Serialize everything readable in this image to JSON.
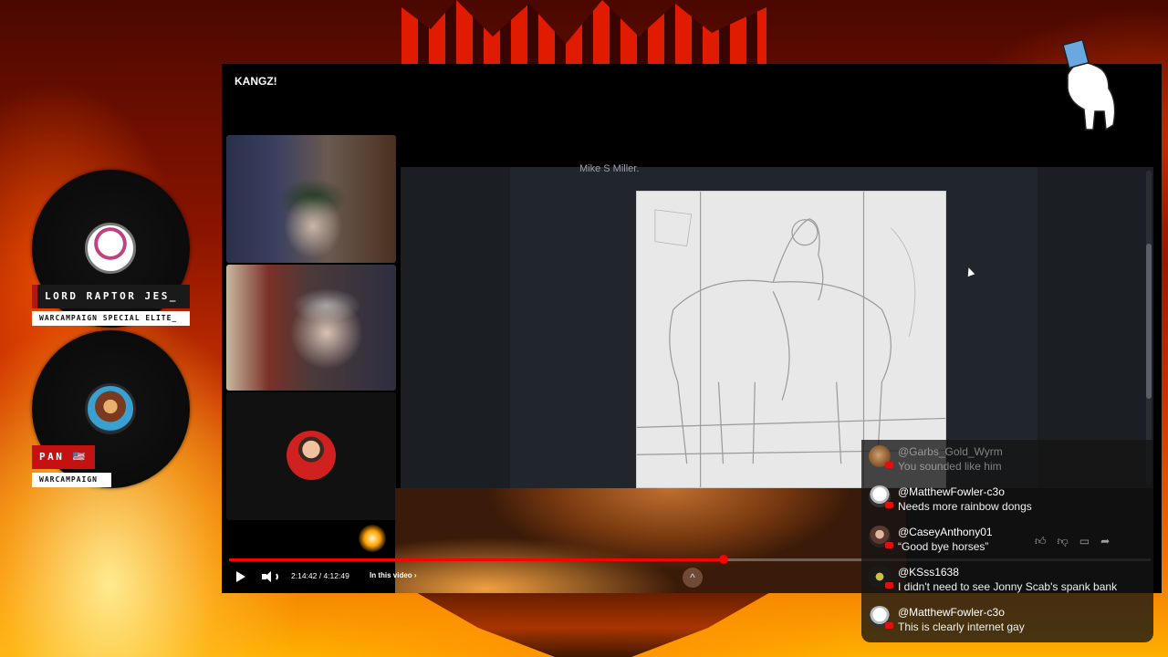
{
  "stream": {
    "video_title": "KANGZ!",
    "doc_caption": "Mike S Miller.",
    "time_display": "2:14:42 / 4:12:49",
    "in_video_label": "In this video",
    "progress_fraction": 0.537,
    "accent_color": "#ff0000"
  },
  "participants": [
    {
      "name": "LORD RAPTOR JES_",
      "subtitle": "WARCAMPAIGN SPECIAL ELITE_"
    },
    {
      "name": "PAN 🇺🇸",
      "subtitle": "WARCAMPAIGN"
    }
  ],
  "chat": {
    "messages": [
      {
        "user": "@Garbs_Gold_Wyrm",
        "text": "You sounded like him"
      },
      {
        "user": "@MatthewFowler-c3o",
        "text": "Needs more rainbow dongs"
      },
      {
        "user": "@CaseyAnthony01",
        "text": "“Good bye horses”"
      },
      {
        "user": "@KSss1638",
        "text": "I didn't need to see Jonny Scab's spank bank"
      },
      {
        "user": "@MatthewFowler-c3o",
        "text": "This is clearly internet gay"
      }
    ]
  },
  "icons": {
    "play": "play-icon",
    "volume": "volume-icon",
    "chevron": "chevron-right-icon",
    "chapters": "chevron-up-icon",
    "like": "thumbs-up-icon",
    "dislike": "thumbs-down-icon",
    "comment": "comment-icon",
    "share": "share-icon"
  }
}
